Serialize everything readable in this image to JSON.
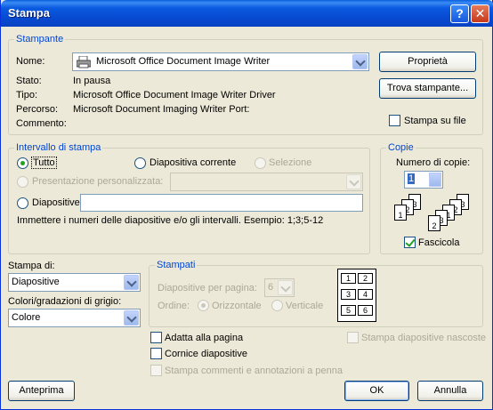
{
  "window": {
    "title": "Stampa",
    "help_glyph": "?",
    "close_glyph": "✕"
  },
  "printer": {
    "group_label": "Stampante",
    "name_label": "Nome:",
    "name_value": "Microsoft Office Document Image Writer",
    "status_label": "Stato:",
    "status_value": "In pausa",
    "type_label": "Tipo:",
    "type_value": "Microsoft Office Document Image Writer Driver",
    "path_label": "Percorso:",
    "path_value": "Microsoft Document Imaging Writer Port:",
    "comment_label": "Commento:",
    "properties_button": "Proprietà",
    "find_printer_button": "Trova stampante...",
    "print_to_file_label": "Stampa su file"
  },
  "range": {
    "group_label": "Intervallo di stampa",
    "all_label": "Tutto",
    "current_slide_label": "Diapositiva corrente",
    "selection_label": "Selezione",
    "custom_show_label": "Presentazione personalizzata:",
    "slides_label": "Diapositive:",
    "hint": "Immettere i numeri delle diapositive e/o gli intervalli. Esempio: 1;3;5-12"
  },
  "copies": {
    "group_label": "Copie",
    "count_label": "Numero di copie:",
    "count_value": "1",
    "collate_label": "Fascicola",
    "collate_checked": true
  },
  "print_what": {
    "label": "Stampa di:",
    "value": "Diapositive"
  },
  "color": {
    "label": "Colori/gradazioni di grigio:",
    "value": "Colore"
  },
  "handouts": {
    "group_label": "Stampati",
    "per_page_label": "Diapositive per pagina:",
    "per_page_value": "6",
    "order_label": "Ordine:",
    "horizontal_label": "Orizzontale",
    "vertical_label": "Verticale",
    "preview_cells": [
      "1",
      "2",
      "3",
      "4",
      "5",
      "6"
    ]
  },
  "options": {
    "fit_label": "Adatta alla pagina",
    "frame_label": "Cornice diapositive",
    "comments_label": "Stampa commenti e annotazioni a penna",
    "hidden_label": "Stampa diapositive nascoste"
  },
  "buttons": {
    "preview": "Anteprima",
    "ok": "OK",
    "cancel": "Annulla"
  }
}
